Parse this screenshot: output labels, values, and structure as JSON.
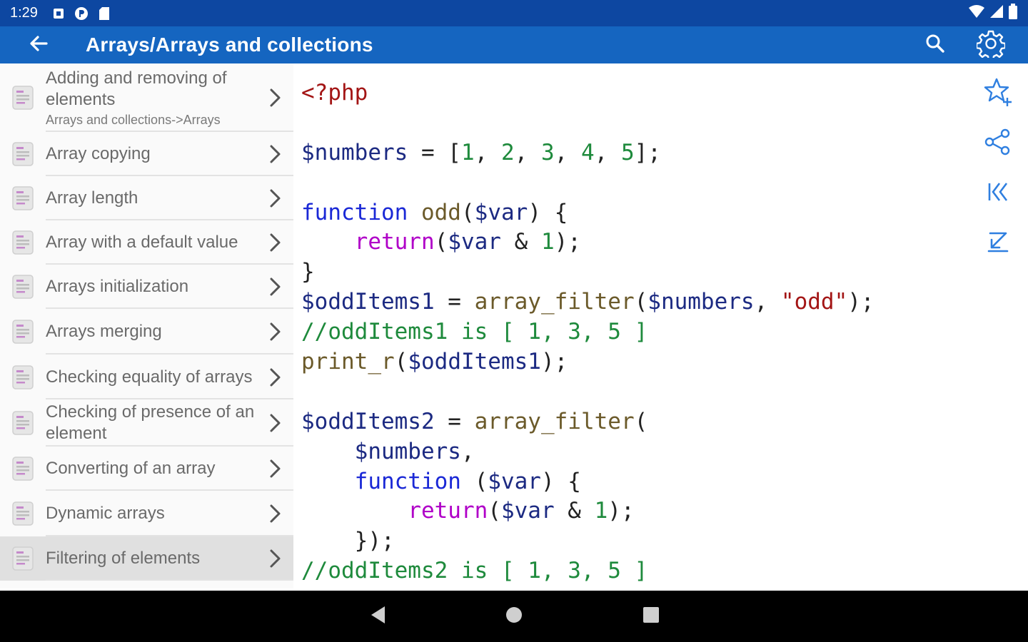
{
  "status_bar": {
    "time": "1:29",
    "left_icons": [
      "notification-square-icon",
      "circle-app-icon",
      "sd-card-icon"
    ],
    "right_icons": [
      "wifi-icon",
      "cell-signal-icon",
      "battery-icon"
    ]
  },
  "appbar": {
    "title": "Arrays/Arrays and collections",
    "back_icon": "arrow-left-icon",
    "actions": [
      "search-icon",
      "gear-icon"
    ],
    "background": "#1565c0"
  },
  "list": {
    "items": [
      {
        "label": "Adding and removing of elements",
        "subtitle": "Arrays and collections->Arrays"
      },
      {
        "label": "Array copying"
      },
      {
        "label": "Array length"
      },
      {
        "label": "Array with a default value"
      },
      {
        "label": "Arrays initialization"
      },
      {
        "label": "Arrays merging"
      },
      {
        "label": "Checking equality of arrays"
      },
      {
        "label": "Checking of presence of an element"
      },
      {
        "label": "Converting of an array"
      },
      {
        "label": "Dynamic arrays"
      },
      {
        "label": "Filtering of elements",
        "selected": true
      }
    ]
  },
  "code": {
    "language": "php",
    "lines": [
      [
        {
          "t": "<?php",
          "c": "php"
        }
      ],
      [],
      [
        {
          "t": "$numbers",
          "c": "var"
        },
        {
          "t": " = [",
          "c": "p"
        },
        {
          "t": "1",
          "c": "num"
        },
        {
          "t": ", ",
          "c": "p"
        },
        {
          "t": "2",
          "c": "num"
        },
        {
          "t": ", ",
          "c": "p"
        },
        {
          "t": "3",
          "c": "num"
        },
        {
          "t": ", ",
          "c": "p"
        },
        {
          "t": "4",
          "c": "num"
        },
        {
          "t": ", ",
          "c": "p"
        },
        {
          "t": "5",
          "c": "num"
        },
        {
          "t": "];",
          "c": "p"
        }
      ],
      [],
      [
        {
          "t": "function",
          "c": "kw"
        },
        {
          "t": " ",
          "c": "p"
        },
        {
          "t": "odd",
          "c": "fn"
        },
        {
          "t": "(",
          "c": "p"
        },
        {
          "t": "$var",
          "c": "var"
        },
        {
          "t": ") {",
          "c": "p"
        }
      ],
      [
        {
          "t": "    ",
          "c": "p"
        },
        {
          "t": "return",
          "c": "ret"
        },
        {
          "t": "(",
          "c": "p"
        },
        {
          "t": "$var",
          "c": "var"
        },
        {
          "t": " & ",
          "c": "p"
        },
        {
          "t": "1",
          "c": "num"
        },
        {
          "t": ");",
          "c": "p"
        }
      ],
      [
        {
          "t": "}",
          "c": "p"
        }
      ],
      [
        {
          "t": "$oddItems1",
          "c": "var"
        },
        {
          "t": " = ",
          "c": "p"
        },
        {
          "t": "array_filter",
          "c": "fn"
        },
        {
          "t": "(",
          "c": "p"
        },
        {
          "t": "$numbers",
          "c": "var"
        },
        {
          "t": ", ",
          "c": "p"
        },
        {
          "t": "\"odd\"",
          "c": "str"
        },
        {
          "t": ");",
          "c": "p"
        }
      ],
      [
        {
          "t": "//oddItems1 is [ 1, 3, 5 ]",
          "c": "cmt"
        }
      ],
      [
        {
          "t": "print_r",
          "c": "fn"
        },
        {
          "t": "(",
          "c": "p"
        },
        {
          "t": "$oddItems1",
          "c": "var"
        },
        {
          "t": ");",
          "c": "p"
        }
      ],
      [],
      [
        {
          "t": "$oddItems2",
          "c": "var"
        },
        {
          "t": " = ",
          "c": "p"
        },
        {
          "t": "array_filter",
          "c": "fn"
        },
        {
          "t": "(",
          "c": "p"
        }
      ],
      [
        {
          "t": "    ",
          "c": "p"
        },
        {
          "t": "$numbers",
          "c": "var"
        },
        {
          "t": ",",
          "c": "p"
        }
      ],
      [
        {
          "t": "    ",
          "c": "p"
        },
        {
          "t": "function",
          "c": "kw"
        },
        {
          "t": " (",
          "c": "p"
        },
        {
          "t": "$var",
          "c": "var"
        },
        {
          "t": ") {",
          "c": "p"
        }
      ],
      [
        {
          "t": "        ",
          "c": "p"
        },
        {
          "t": "return",
          "c": "ret"
        },
        {
          "t": "(",
          "c": "p"
        },
        {
          "t": "$var",
          "c": "var"
        },
        {
          "t": " & ",
          "c": "p"
        },
        {
          "t": "1",
          "c": "num"
        },
        {
          "t": ");",
          "c": "p"
        }
      ],
      [
        {
          "t": "    });",
          "c": "p"
        }
      ],
      [
        {
          "t": "//oddItems2 is [ 1, 3, 5 ]",
          "c": "cmt"
        }
      ]
    ]
  },
  "side_tools": [
    "star-add-icon",
    "share-icon",
    "skip-to-start-icon",
    "scroll-to-end-icon"
  ],
  "nav_bar": [
    "nav-back-icon",
    "nav-home-icon",
    "nav-recents-icon"
  ],
  "colors": {
    "status_bar": "#0d47a1",
    "app_bar": "#1565c0",
    "accent_icon": "#2f7fe0",
    "list_bg": "#fafafa",
    "selected_bg": "#e0e0e0"
  }
}
